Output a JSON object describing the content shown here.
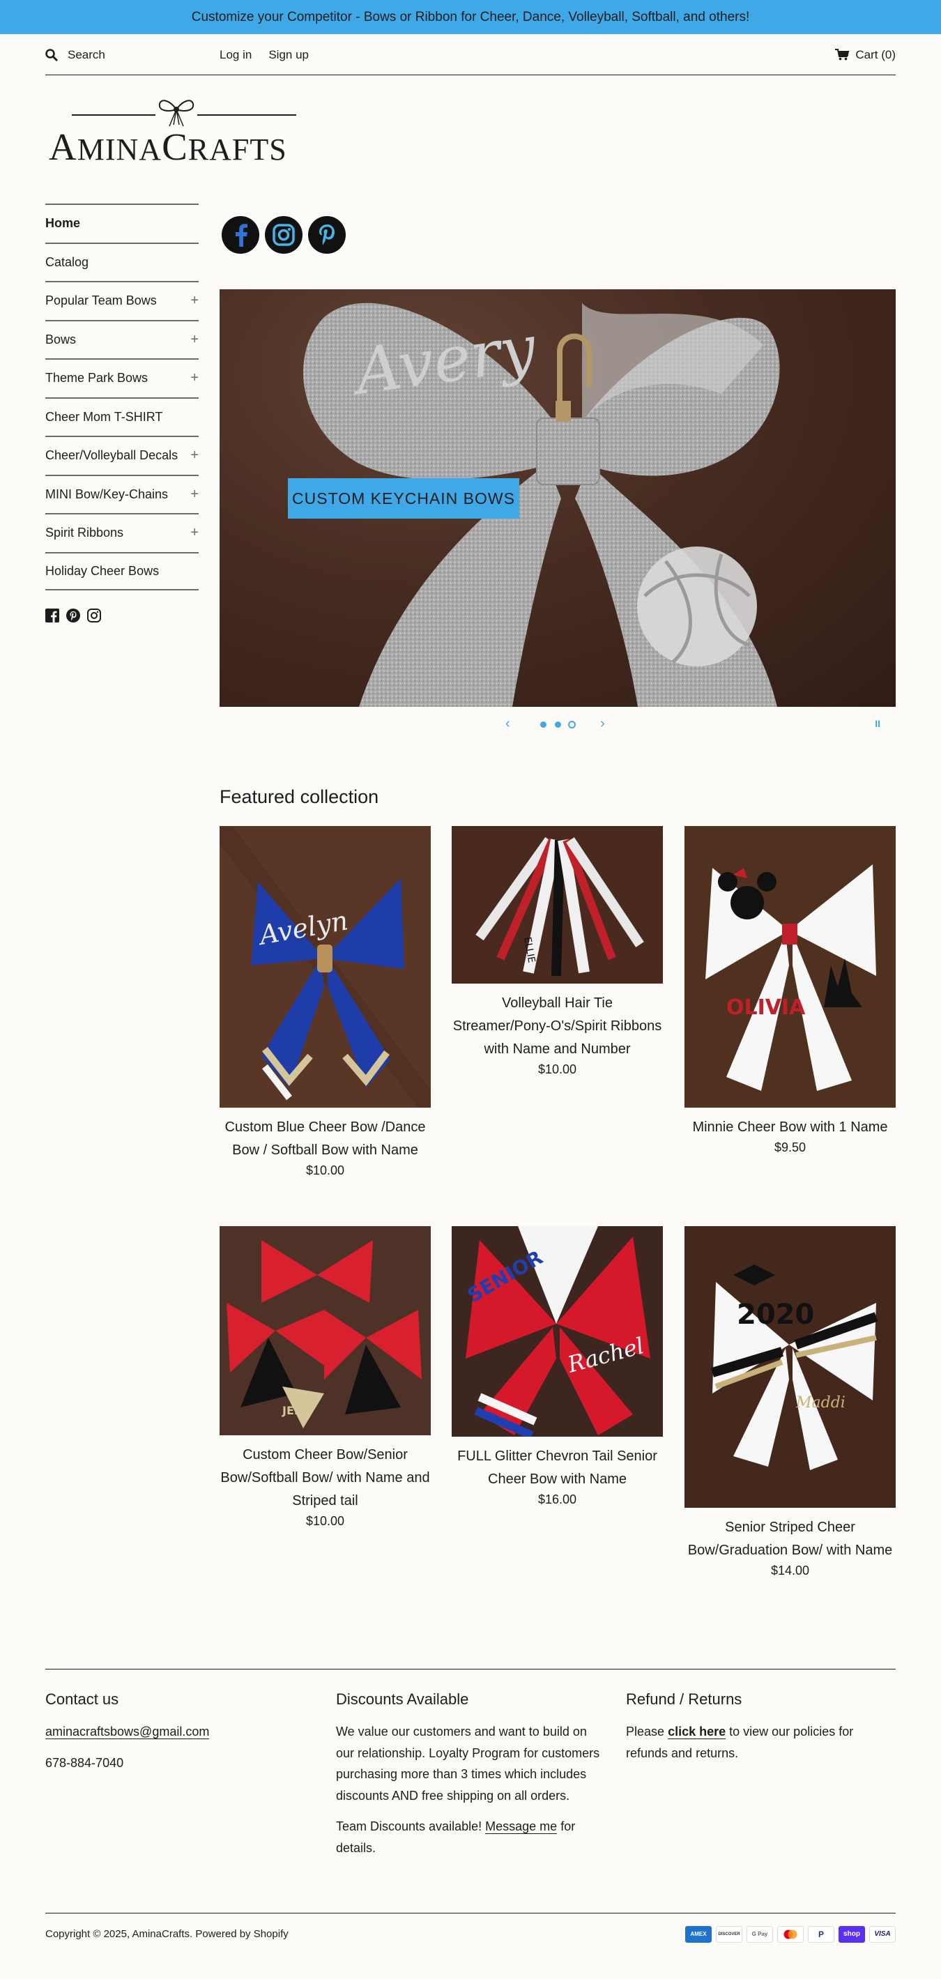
{
  "announcement": "Customize your Competitor - Bows or Ribbon for Cheer, Dance, Volleyball, Softball, and others!",
  "topbar": {
    "search_placeholder": "Search",
    "login": "Log in",
    "signup": "Sign up",
    "cart": "Cart (0)"
  },
  "logo": {
    "first": "A",
    "rest1": "MINA",
    "second": "C",
    "rest2": "RAFTS"
  },
  "sidenav": {
    "items": [
      {
        "label": "Home",
        "plus": ""
      },
      {
        "label": "Catalog",
        "plus": ""
      },
      {
        "label": "Popular Team Bows",
        "plus": "+"
      },
      {
        "label": "Bows",
        "plus": "+"
      },
      {
        "label": "Theme Park Bows",
        "plus": "+"
      },
      {
        "label": "Cheer Mom T-SHIRT",
        "plus": ""
      },
      {
        "label": "Cheer/Volleyball Decals",
        "plus": "+"
      },
      {
        "label": "MINI Bow/Key-Chains",
        "plus": "+"
      },
      {
        "label": "Spirit Ribbons",
        "plus": "+"
      },
      {
        "label": "Holiday Cheer Bows",
        "plus": ""
      }
    ]
  },
  "hero": {
    "button": "CUSTOM KEYCHAIN BOWS",
    "bow_text": "Avery",
    "arrow_prev": "‹",
    "arrow_next": "›",
    "pause": "II"
  },
  "featured": {
    "title": "Featured collection",
    "products": [
      {
        "name": "Custom Blue Cheer Bow /Dance Bow / Softball Bow with Name",
        "price": "$10.00",
        "label": "Avelyn"
      },
      {
        "name": "Volleyball Hair Tie Streamer/Pony-O's/Spirit Ribbons with Name and Number",
        "price": "$10.00",
        "label": "ELLIE"
      },
      {
        "name": "Minnie Cheer Bow with 1 Name",
        "price": "$9.50",
        "label": "OLIVIA"
      },
      {
        "name": "Custom Cheer Bow/Senior Bow/Softball Bow/ with Name and Striped tail",
        "price": "$10.00",
        "label": "JELLY"
      },
      {
        "name": "FULL Glitter Chevron Tail Senior Cheer Bow with Name",
        "price": "$16.00",
        "label": "Rachel"
      },
      {
        "name": "Senior Striped Cheer Bow/Graduation Bow/ with Name",
        "price": "$14.00",
        "label": "2020"
      }
    ]
  },
  "footer": {
    "contact_title": "Contact us",
    "email": "aminacraftsbows@gmail.com",
    "phone": "678-884-7040",
    "discounts_title": "Discounts Available",
    "discounts_text": "We value our customers and want to build on our relationship. Loyalty Program for customers purchasing more than 3 times which includes discounts AND free shipping on all orders.",
    "team_text_1": "Team Discounts available!",
    "message_me": "Message me",
    "team_text_2": "for details.",
    "refund_title": "Refund / Returns",
    "refund_1": "Please",
    "click_here": "click here",
    "refund_2": "to view our policies for refunds and returns.",
    "copyright": "Copyright © 2025,",
    "brand": "AminaCrafts",
    "powered": ". Powered by Shopify",
    "payments": [
      "AMEX",
      "DISCOVER",
      "G Pay",
      "MC",
      "P",
      "shop",
      "VISA"
    ]
  },
  "colors": {
    "accent": "#3fa9e8",
    "text": "#1c1d1d",
    "background": "#fcfbf8"
  }
}
